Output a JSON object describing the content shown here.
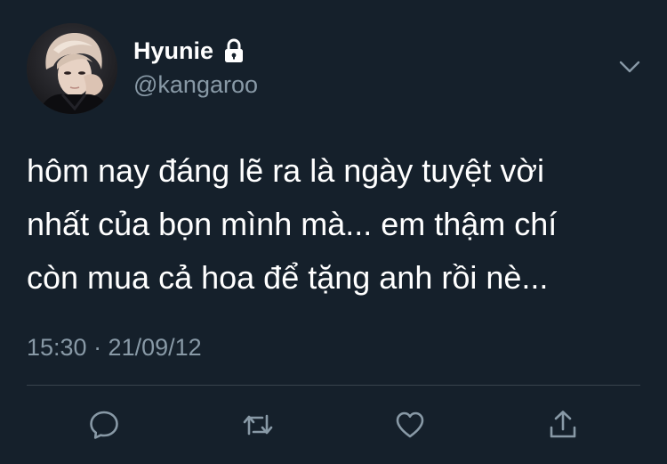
{
  "colors": {
    "background": "#15202b",
    "primary_text": "#ffffff",
    "secondary_text": "#8899a6",
    "divider": "#38444d"
  },
  "author": {
    "display_name": "Hyunie",
    "handle": "@kangaroo",
    "protected_icon": "lock-icon",
    "avatar": "profile-photo"
  },
  "tweet": {
    "text_lines": [
      "hôm nay đáng lẽ ra là ngày tuyệt vời",
      "nhất của bọn mình mà... em thậm chí",
      "còn mua cả hoa để tặng anh rồi nè..."
    ],
    "timestamp": "15:30 · 21/09/12"
  },
  "menu": {
    "icon": "chevron-down-icon"
  },
  "actions": [
    {
      "name": "reply",
      "icon": "reply-icon"
    },
    {
      "name": "retweet",
      "icon": "retweet-icon"
    },
    {
      "name": "like",
      "icon": "heart-icon"
    },
    {
      "name": "share",
      "icon": "share-icon"
    }
  ]
}
